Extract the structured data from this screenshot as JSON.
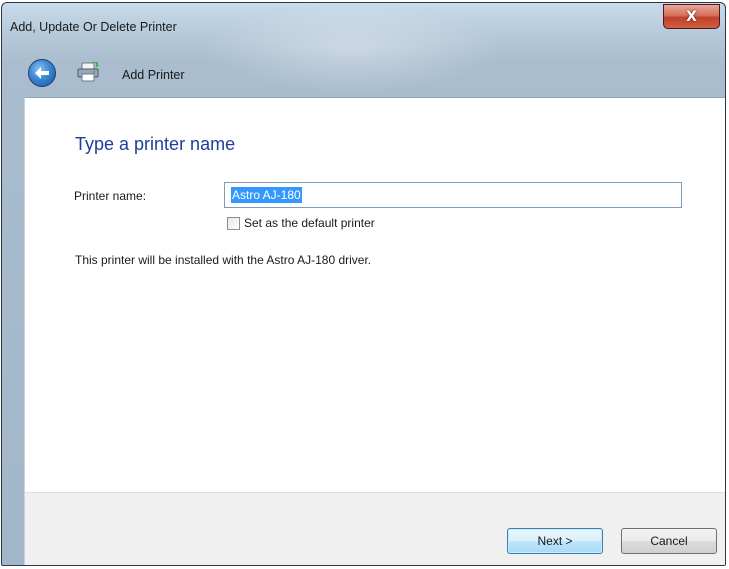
{
  "window": {
    "title": "Add, Update Or Delete Printer",
    "close_label": "X"
  },
  "nav": {
    "title": "Add Printer"
  },
  "content": {
    "heading": "Type a printer name",
    "printer_name_label": "Printer name:",
    "printer_name_value": "Astro AJ-180",
    "default_checkbox_label": "Set as the default printer",
    "default_checked": false,
    "info": "This printer will be installed with the Astro AJ-180 driver."
  },
  "footer": {
    "next_label": "Next >",
    "cancel_label": "Cancel"
  },
  "icons": {
    "back": "back-arrow-icon",
    "wizard": "printer-icon",
    "close": "close-icon"
  },
  "colors": {
    "heading": "#1e3f9a",
    "selection": "#3399ff",
    "close_button": "#c0412a"
  }
}
